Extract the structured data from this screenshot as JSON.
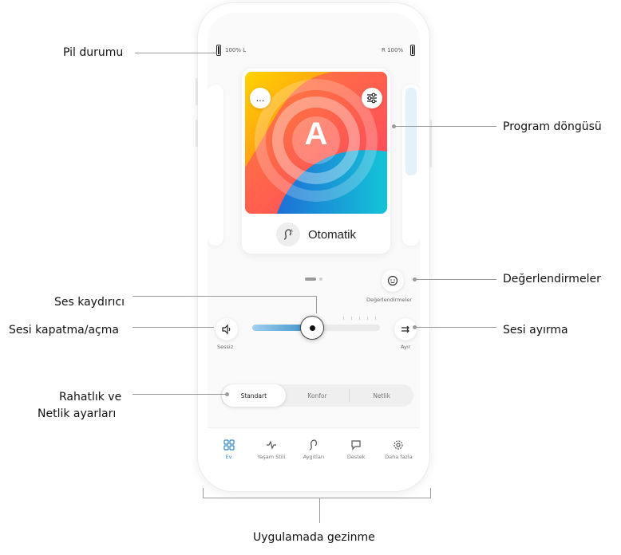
{
  "status": {
    "left_battery": "100% L",
    "right_battery": "R 100%"
  },
  "program": {
    "letter": "A",
    "name": "Otomatik",
    "more_label": "…"
  },
  "controls": {
    "ratings_label": "Değerlendirmeler",
    "mute_label": "Sessiz",
    "split_label": "Ayır",
    "volume_level": 0.47
  },
  "comfort_modes": [
    {
      "label": "Standart",
      "selected": true
    },
    {
      "label": "Konfor",
      "selected": false
    },
    {
      "label": "Netlik",
      "selected": false
    }
  ],
  "nav": [
    {
      "label": "Ev",
      "icon": "grid-icon",
      "active": true
    },
    {
      "label": "Yaşam Stili",
      "icon": "activity-icon",
      "active": false
    },
    {
      "label": "Aygıtları",
      "icon": "hearing-aid-icon",
      "active": false
    },
    {
      "label": "Destek",
      "icon": "chat-icon",
      "active": false
    },
    {
      "label": "Daha fazla",
      "icon": "gear-icon",
      "active": false
    }
  ],
  "callouts": {
    "battery": "Pil durumu",
    "program_carousel": "Program döngüsü",
    "ratings": "Değerlendirmeler",
    "volume_slider": "Ses kaydırıcı",
    "mute": "Sesi kapatma/açma",
    "split": "Sesi ayırma",
    "comfort_line1": "Rahatlık ve",
    "comfort_line2": "Netlik ayarları",
    "navigation": "Uygulamada gezinme"
  },
  "colors": {
    "accent": "#2f86c4",
    "slider_fill": "#3a8fca"
  }
}
